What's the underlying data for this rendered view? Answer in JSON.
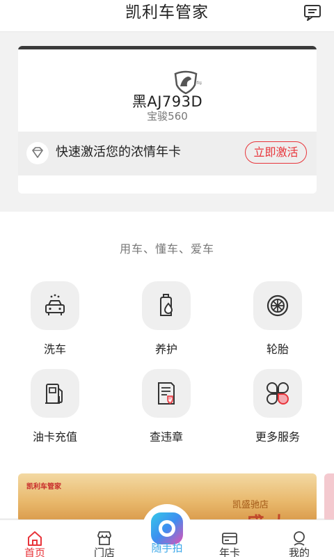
{
  "header": {
    "title": "凯利车管家",
    "message_icon": "message-icon"
  },
  "car_card": {
    "logo_icon": "baojun-logo-icon",
    "swap_symbol": "⇋",
    "plate": "黑AJ793D",
    "model": "宝骏560",
    "activate_text": "快速激活您的浓情年卡",
    "activate_button": "立即激活",
    "accent_color": "#e8343a"
  },
  "services": {
    "slogan": "用车、懂车、爱车",
    "items": [
      {
        "label": "洗车",
        "icon": "car-wash-icon"
      },
      {
        "label": "养护",
        "icon": "oil-bottle-icon"
      },
      {
        "label": "轮胎",
        "icon": "tire-icon"
      },
      {
        "label": "油卡充值",
        "icon": "fuel-pump-icon"
      },
      {
        "label": "查违章",
        "icon": "violation-document-icon"
      },
      {
        "label": "更多服务",
        "icon": "more-services-icon"
      }
    ]
  },
  "banner": {
    "brand": "凯利车管家",
    "store": "凯盛驰店",
    "headline": "盛大"
  },
  "tabbar": {
    "tabs": [
      {
        "label": "首页",
        "icon": "home-icon",
        "active": true
      },
      {
        "label": "门店",
        "icon": "store-icon",
        "active": false
      },
      {
        "label": "随手拍",
        "icon": "camera-icon",
        "active": false
      },
      {
        "label": "年卡",
        "icon": "card-icon",
        "active": false
      },
      {
        "label": "我的",
        "icon": "profile-icon",
        "active": false
      }
    ]
  }
}
